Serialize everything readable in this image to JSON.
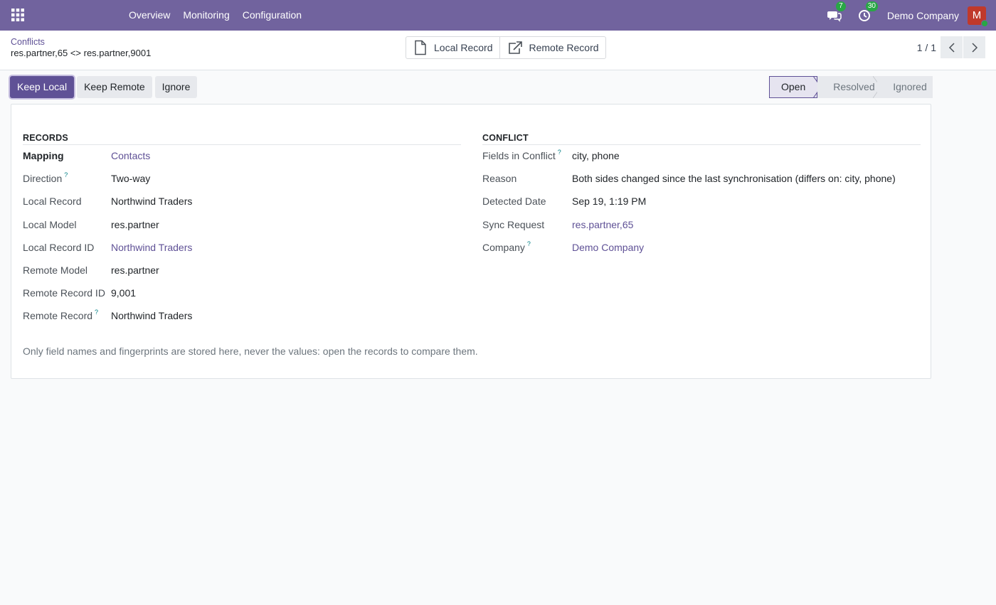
{
  "navbar": {
    "menu": [
      "Overview",
      "Monitoring",
      "Configuration"
    ],
    "messages_count": "7",
    "activities_count": "30",
    "company": "Demo Company",
    "avatar_initial": "M"
  },
  "control_panel": {
    "breadcrumb": "Conflicts",
    "record_title": "res.partner,65 <> res.partner,9001",
    "smart_buttons": {
      "local_record": "Local Record",
      "remote_record": "Remote Record"
    },
    "pager": "1 / 1"
  },
  "actions": {
    "keep_local": "Keep Local",
    "keep_remote": "Keep Remote",
    "ignore": "Ignore"
  },
  "statusbar": {
    "steps": [
      "Open",
      "Resolved",
      "Ignored"
    ],
    "current": "Open"
  },
  "records_group": {
    "title": "RECORDS",
    "fields": [
      {
        "label": "Mapping",
        "value": "Contacts"
      },
      {
        "label": "Direction",
        "value": "Two-way"
      },
      {
        "label": "Local Record",
        "value": "Northwind Traders"
      },
      {
        "label": "Local Model",
        "value": "res.partner"
      },
      {
        "label": "Local Record ID",
        "value": "Northwind Traders"
      },
      {
        "label": "Remote Model",
        "value": "res.partner"
      },
      {
        "label": "Remote Record ID",
        "value": "9,001"
      },
      {
        "label": "Remote Record",
        "value": "Northwind Traders"
      }
    ],
    "note": "Only field names and fingerprints are stored here, never the values: open the records to compare them."
  },
  "conflict_group": {
    "title": "CONFLICT",
    "fields": [
      {
        "label": "Fields in Conflict",
        "value": "city, phone"
      },
      {
        "label": "Reason",
        "value": "Both sides changed since the last synchronisation (differs on: city, phone)"
      },
      {
        "label": "Detected Date",
        "value": "Sep 19, 1:19 PM"
      },
      {
        "label": "Sync Request",
        "value": "res.partner,65"
      },
      {
        "label": "Company",
        "value": "Demo Company"
      }
    ]
  },
  "help_marker": "?",
  "colors": {
    "navbar": "#71639e",
    "primary": "#5f5196",
    "link": "#5f5196",
    "background": "#f9fafb"
  }
}
